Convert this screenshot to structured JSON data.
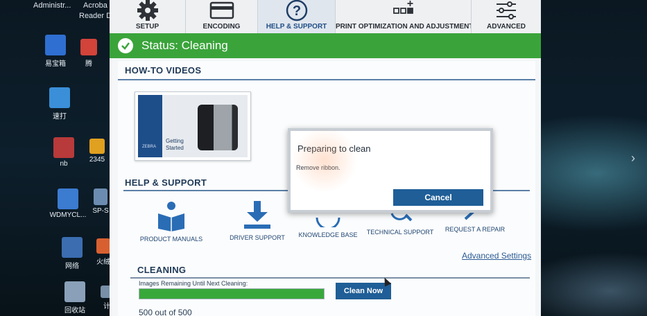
{
  "desktop": {
    "top_items": [
      {
        "label": "Administr..."
      },
      {
        "label": "Acroba"
      },
      {
        "label": "Reader D"
      }
    ],
    "icons": [
      {
        "label": "易宝箱",
        "color": "#2f6fd1"
      },
      {
        "label": "腾",
        "color": "#d2433a"
      },
      {
        "label": "速打",
        "color": "#3a8fd8"
      },
      {
        "label": "nb",
        "color": "#b83a3a"
      },
      {
        "label": "2345",
        "color": "#e0a020"
      },
      {
        "label": "WDMYCL...",
        "color": "#3b7bd0"
      },
      {
        "label": "SP-S",
        "color": "#6b8cb0"
      },
      {
        "label": "网络",
        "color": "#3b6db0"
      },
      {
        "label": "火绒",
        "color": "#d86030"
      },
      {
        "label": "回收站",
        "color": "#8aa0b8"
      },
      {
        "label": "计",
        "color": "#7890a8"
      }
    ]
  },
  "app": {
    "nav": {
      "tabs": [
        {
          "label": "SETUP",
          "icon": "gear-icon",
          "active": false
        },
        {
          "label": "ENCODING",
          "icon": "card-icon",
          "active": false
        },
        {
          "label": "HELP & SUPPORT",
          "icon": "question-icon",
          "active": true
        },
        {
          "label": "PRINT OPTIMIZATION AND ADJUSTMENT",
          "icon": "grid-plus-icon",
          "active": false
        },
        {
          "label": "ADVANCED",
          "icon": "sliders-icon",
          "active": false
        }
      ]
    },
    "status": {
      "text": "Status: Cleaning",
      "color": "#3aa43a"
    },
    "howto": {
      "title": "HOW-TO VIDEOS",
      "video_caption_1": "Getting",
      "video_caption_2": "Started",
      "video_brand": "ZEBRA"
    },
    "help": {
      "title": "HELP & SUPPORT",
      "items": [
        {
          "label": "PRODUCT MANUALS",
          "icon": "manual-reader-icon"
        },
        {
          "label": "DRIVER SUPPORT",
          "icon": "download-icon"
        },
        {
          "label": "KNOWLEDGE BASE",
          "icon": "lightbulb-icon"
        },
        {
          "label": "TECHNICAL SUPPORT",
          "icon": "magnifier-icon"
        },
        {
          "label": "REQUEST A REPAIR",
          "icon": "wrench-icon"
        }
      ],
      "advanced_link": "Advanced Settings"
    },
    "cleaning": {
      "title": "CLEANING",
      "label": "Images Remaining Until Next Cleaning:",
      "progress": 1.0,
      "button": "Clean Now",
      "count_text": "500 out of 500"
    },
    "modal": {
      "title": "Preparing to clean",
      "message": "Remove ribbon.",
      "cancel": "Cancel"
    }
  }
}
